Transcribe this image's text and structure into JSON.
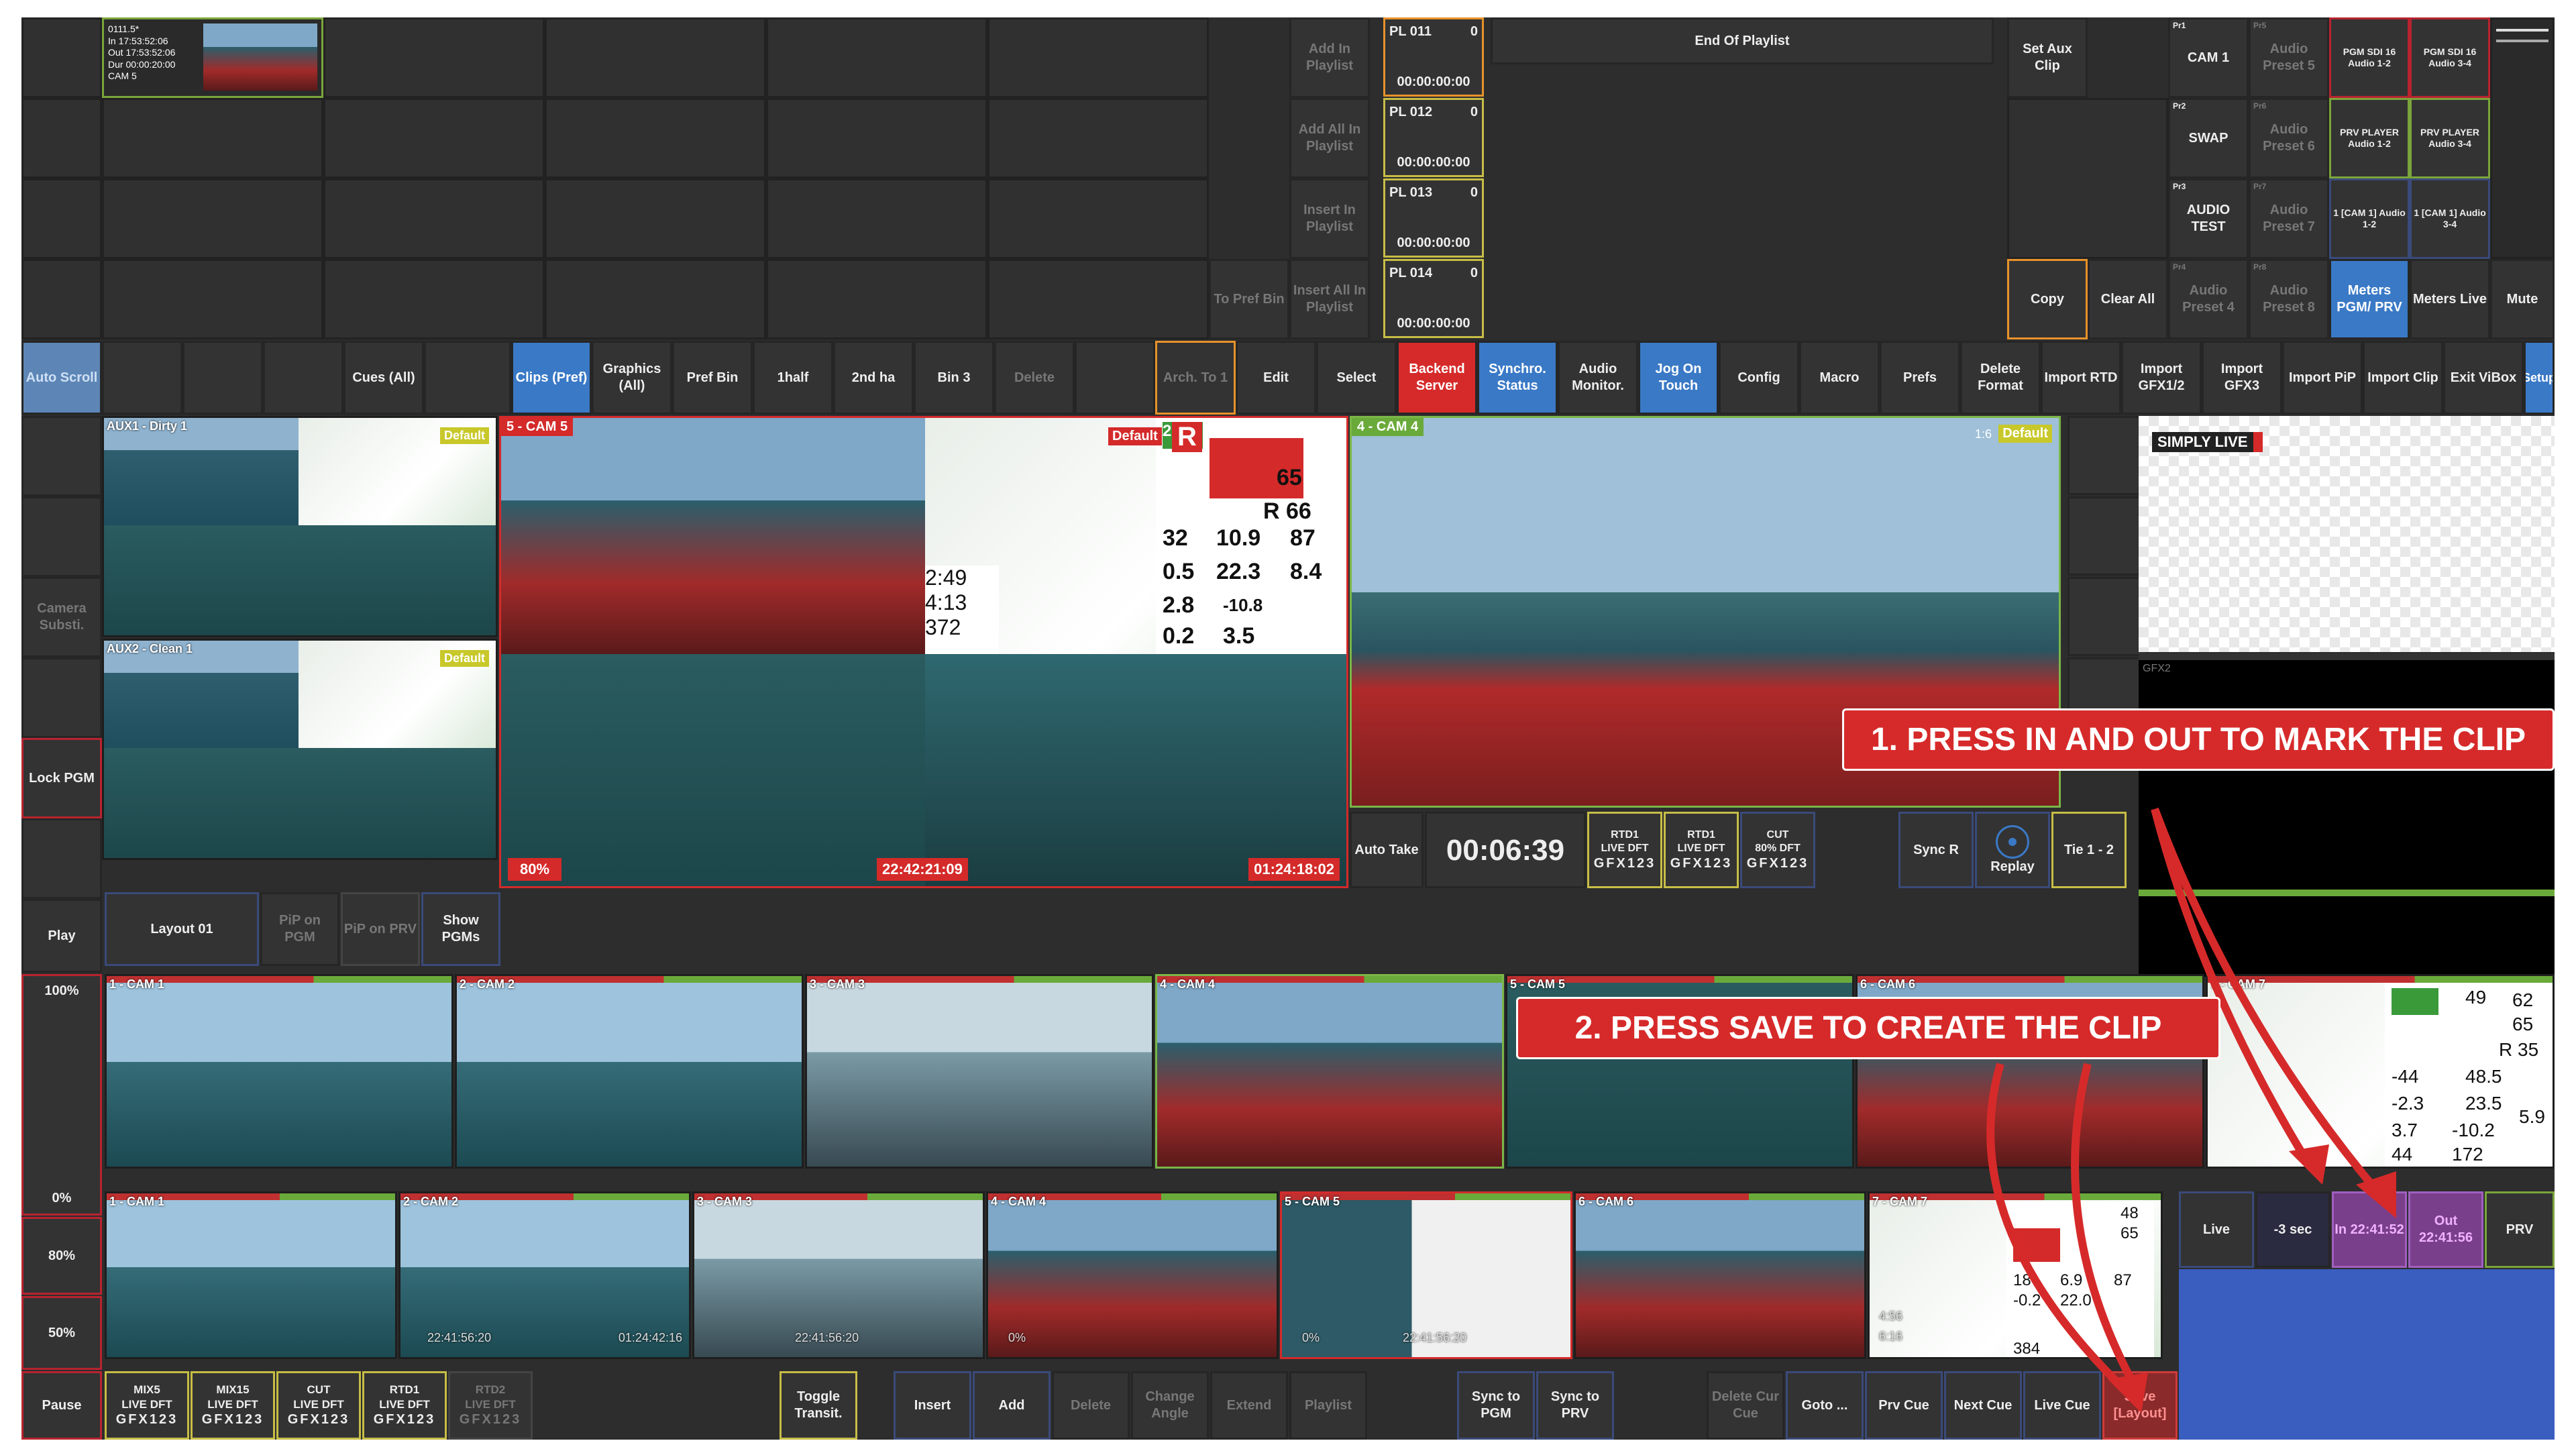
{
  "top_clip": {
    "name": "0111.5*",
    "in": "In 17:53:52:06",
    "out": "Out 17:53:52:06",
    "dur": "Dur 00:00:20:00",
    "cam": "CAM 5"
  },
  "playlist_actions": [
    "Add In Playlist",
    "Add All In Playlist",
    "Insert In Playlist",
    "Insert All In Playlist"
  ],
  "to_pref_bin": "To Pref Bin",
  "playlist_items": [
    {
      "name": "PL 011",
      "count": "0",
      "tc": "00:00:00:00"
    },
    {
      "name": "PL 012",
      "count": "0",
      "tc": "00:00:00:00"
    },
    {
      "name": "PL 013",
      "count": "0",
      "tc": "00:00:00:00"
    },
    {
      "name": "PL 014",
      "count": "0",
      "tc": "00:00:00:00"
    }
  ],
  "end_of_playlist": "End Of Playlist",
  "set_aux_clip": "Set Aux Clip",
  "copy": "Copy",
  "clear_all": "Clear All",
  "presets": [
    {
      "tag": "Pr1",
      "label": "CAM 1"
    },
    {
      "tag": "Pr5",
      "label": "Audio Preset 5"
    },
    {
      "tag": "Pr2",
      "label": "SWAP"
    },
    {
      "tag": "Pr6",
      "label": "Audio Preset 6"
    },
    {
      "tag": "Pr3",
      "label": "AUDIO TEST"
    },
    {
      "tag": "Pr7",
      "label": "Audio Preset 7"
    },
    {
      "tag": "Pr4",
      "label": "Audio Preset 4"
    },
    {
      "tag": "Pr8",
      "label": "Audio Preset 8"
    }
  ],
  "audio_routes": [
    "PGM SDI 16 Audio 1-2",
    "PGM SDI 16 Audio 3-4",
    "PRV PLAYER Audio 1-2",
    "PRV PLAYER Audio 3-4",
    "1 [CAM 1] Audio 1-2",
    "1 [CAM 1] Audio 3-4"
  ],
  "meters_pgm_prv": "Meters PGM/ PRV",
  "meters_live": "Meters Live",
  "mute": "Mute",
  "auto_scroll": "Auto Scroll",
  "toolbar": [
    {
      "label": "Cues (All)"
    },
    {
      "label": "Clips (Pref)"
    },
    {
      "label": "Graphics (All)"
    },
    {
      "label": "Pref Bin"
    },
    {
      "label": "1half"
    },
    {
      "label": "2nd ha"
    },
    {
      "label": "Bin 3"
    },
    {
      "label": "Delete"
    },
    {
      "label": "Arch. To 1"
    },
    {
      "label": "Edit"
    },
    {
      "label": "Select"
    },
    {
      "label": "Backend Server"
    },
    {
      "label": "Synchro. Status"
    },
    {
      "label": "Audio Monitor."
    },
    {
      "label": "Jog On Touch"
    },
    {
      "label": "Config"
    },
    {
      "label": "Macro"
    },
    {
      "label": "Prefs"
    },
    {
      "label": "Delete Format"
    },
    {
      "label": "Import RTD"
    },
    {
      "label": "Import GFX1/2"
    },
    {
      "label": "Import GFX3"
    },
    {
      "label": "Import PiP"
    },
    {
      "label": "Import Clip"
    },
    {
      "label": "Exit ViBox"
    },
    {
      "label": "Setup"
    }
  ],
  "side_left": {
    "camera_subst": "Camera Substi.",
    "lock_pgm": "Lock PGM",
    "play": "Play",
    "pct100": "100%",
    "pct0": "0%",
    "pct80": "80%",
    "pct50": "50%",
    "pause": "Pause"
  },
  "aux1": {
    "label": "AUX1 - Dirty 1",
    "badge": "Default"
  },
  "aux2": {
    "label": "AUX2 - Clean 1",
    "badge": "Default"
  },
  "prv_monitor": {
    "label": "5 - CAM 5",
    "badge": "Default",
    "letter": "R",
    "zoom": "80%",
    "tc1": "22:42:21:09",
    "tc2": "01:24:18:02"
  },
  "stats": [
    "29",
    "65",
    "R 66",
    "32",
    "10.9",
    "87",
    "0.5",
    "22.3",
    "8.4",
    "2.8",
    "-10.8",
    "0.2",
    "3.5",
    "2:49",
    "4:13",
    "372"
  ],
  "pgm_monitor": {
    "label": "4 - CAM 4",
    "badge": "Default",
    "ratio": "1:6"
  },
  "auto_take": "Auto Take",
  "timer": "00:06:39",
  "mix_small": [
    {
      "top": "RTD1",
      "mid": "LIVE DFT",
      "gfx": "GFX123"
    },
    {
      "top": "RTD1",
      "mid": "LIVE DFT",
      "gfx": "GFX123"
    },
    {
      "top": "CUT",
      "mid": "80% DFT",
      "gfx": "GFX123"
    }
  ],
  "sync_r": "Sync R",
  "replay": "Replay",
  "tie": "Tie 1 - 2",
  "simply_live": "SIMPLY LIVE",
  "gfx2": "GFX2",
  "layout": {
    "name": "Layout 01",
    "pip_pgm": "PiP on PGM",
    "pip_prv": "PiP on PRV",
    "show_pgms": "Show PGMs"
  },
  "cams_top": [
    "1 - CAM 1",
    "2 - CAM 2",
    "3 - CAM 3",
    "4 - CAM 4",
    "5 - CAM 5",
    "6 - CAM 6",
    "7 - CAM 7"
  ],
  "cams_bottom": [
    "1 - CAM 1",
    "2 - CAM 2",
    "3 - CAM 3",
    "4 - CAM 4",
    "5 - CAM 5",
    "6 - CAM 6",
    "7 - CAM 7"
  ],
  "cam_bottom_tc": [
    "0%",
    "22:41:56:20",
    "01:24:42:16"
  ],
  "cam7_stats": [
    "49",
    "62",
    "65",
    "R 35",
    "-44",
    "48.5",
    "-2.3",
    "23.5",
    "3.7",
    "-10.2",
    "5.9",
    "44",
    "172"
  ],
  "cam7b_stats": [
    "48",
    "65",
    "18",
    "6.9",
    "87",
    "-0.2",
    "22.0",
    "384",
    "4:56",
    "6:16"
  ],
  "transport": {
    "live": "Live",
    "minus3": "-3 sec",
    "in": "In 22:41:52",
    "out": "Out 22:41:56",
    "prv": "PRV"
  },
  "bottom_mix": [
    {
      "top": "MIX5",
      "mid": "LIVE DFT",
      "gfx": "GFX123"
    },
    {
      "top": "MIX15",
      "mid": "LIVE DFT",
      "gfx": "GFX123"
    },
    {
      "top": "CUT",
      "mid": "LIVE DFT",
      "gfx": "GFX123"
    },
    {
      "top": "RTD1",
      "mid": "LIVE DFT",
      "gfx": "GFX123"
    },
    {
      "top": "RTD2",
      "mid": "LIVE DFT",
      "gfx": "GFX123"
    }
  ],
  "toggle_transit": "Toggle Transit.",
  "bottom_actions": [
    "Insert",
    "Add",
    "Delete",
    "Change Angle",
    "Extend",
    "Playlist"
  ],
  "sync_pgm": "Sync to PGM",
  "sync_prv": "Sync to PRV",
  "delete_cur_cue": "Delete Cur Cue",
  "goto": "Goto ...",
  "prv_cue": "Prv Cue",
  "next_cue": "Next Cue",
  "live_cue": "Live Cue",
  "save_layout": "Save [Layout]",
  "annotation1": "1. PRESS IN AND OUT TO MARK THE CLIP",
  "annotation2": "2. PRESS SAVE TO CREATE THE CLIP",
  "colors": {
    "accent_blue": "#3a79c6",
    "record_red": "#d62a2a",
    "purple": "#7a3f8a",
    "annotation_red": "#d62a2a"
  }
}
